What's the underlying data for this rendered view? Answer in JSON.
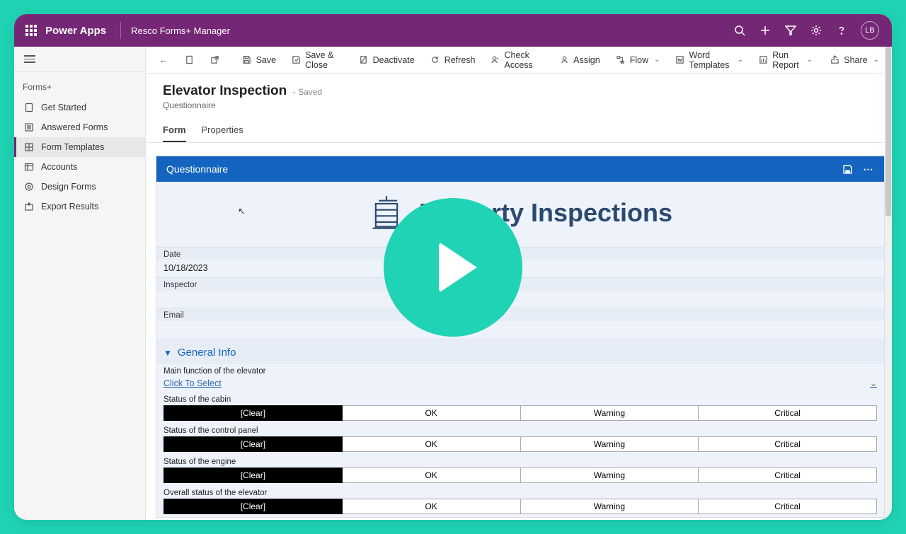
{
  "topbar": {
    "app": "Power Apps",
    "studio": "Resco Forms+ Manager",
    "avatar_initials": "LB"
  },
  "sidebar": {
    "section": "Forms+",
    "items": [
      {
        "label": "Get Started"
      },
      {
        "label": "Answered Forms"
      },
      {
        "label": "Form Templates"
      },
      {
        "label": "Accounts"
      },
      {
        "label": "Design Forms"
      },
      {
        "label": "Export Results"
      }
    ]
  },
  "commands": {
    "save": "Save",
    "save_close": "Save & Close",
    "deactivate": "Deactivate",
    "refresh": "Refresh",
    "check_access": "Check Access",
    "assign": "Assign",
    "flow": "Flow",
    "word_templates": "Word Templates",
    "run_report": "Run Report",
    "share": "Share"
  },
  "record": {
    "title": "Elevator Inspection",
    "saved": "- Saved",
    "subtitle": "Questionnaire",
    "tabs": [
      "Form",
      "Properties"
    ]
  },
  "questionnaire": {
    "header": "Questionnaire",
    "hero_title": "Property Inspections",
    "fields": {
      "date_label": "Date",
      "date_value": "10/18/2023",
      "inspector_label": "Inspector",
      "inspector_value": "",
      "email_label": "Email",
      "email_value": ""
    },
    "section_title": "General Info",
    "main_function_label": "Main function of the elevator",
    "main_function_placeholder": "Click To Select",
    "status_options": [
      "[Clear]",
      "OK",
      "Warning",
      "Critical"
    ],
    "status_questions": [
      "Status of the cabin",
      "Status of the control panel",
      "Status of the engine",
      "Overall status of the elevator"
    ]
  }
}
